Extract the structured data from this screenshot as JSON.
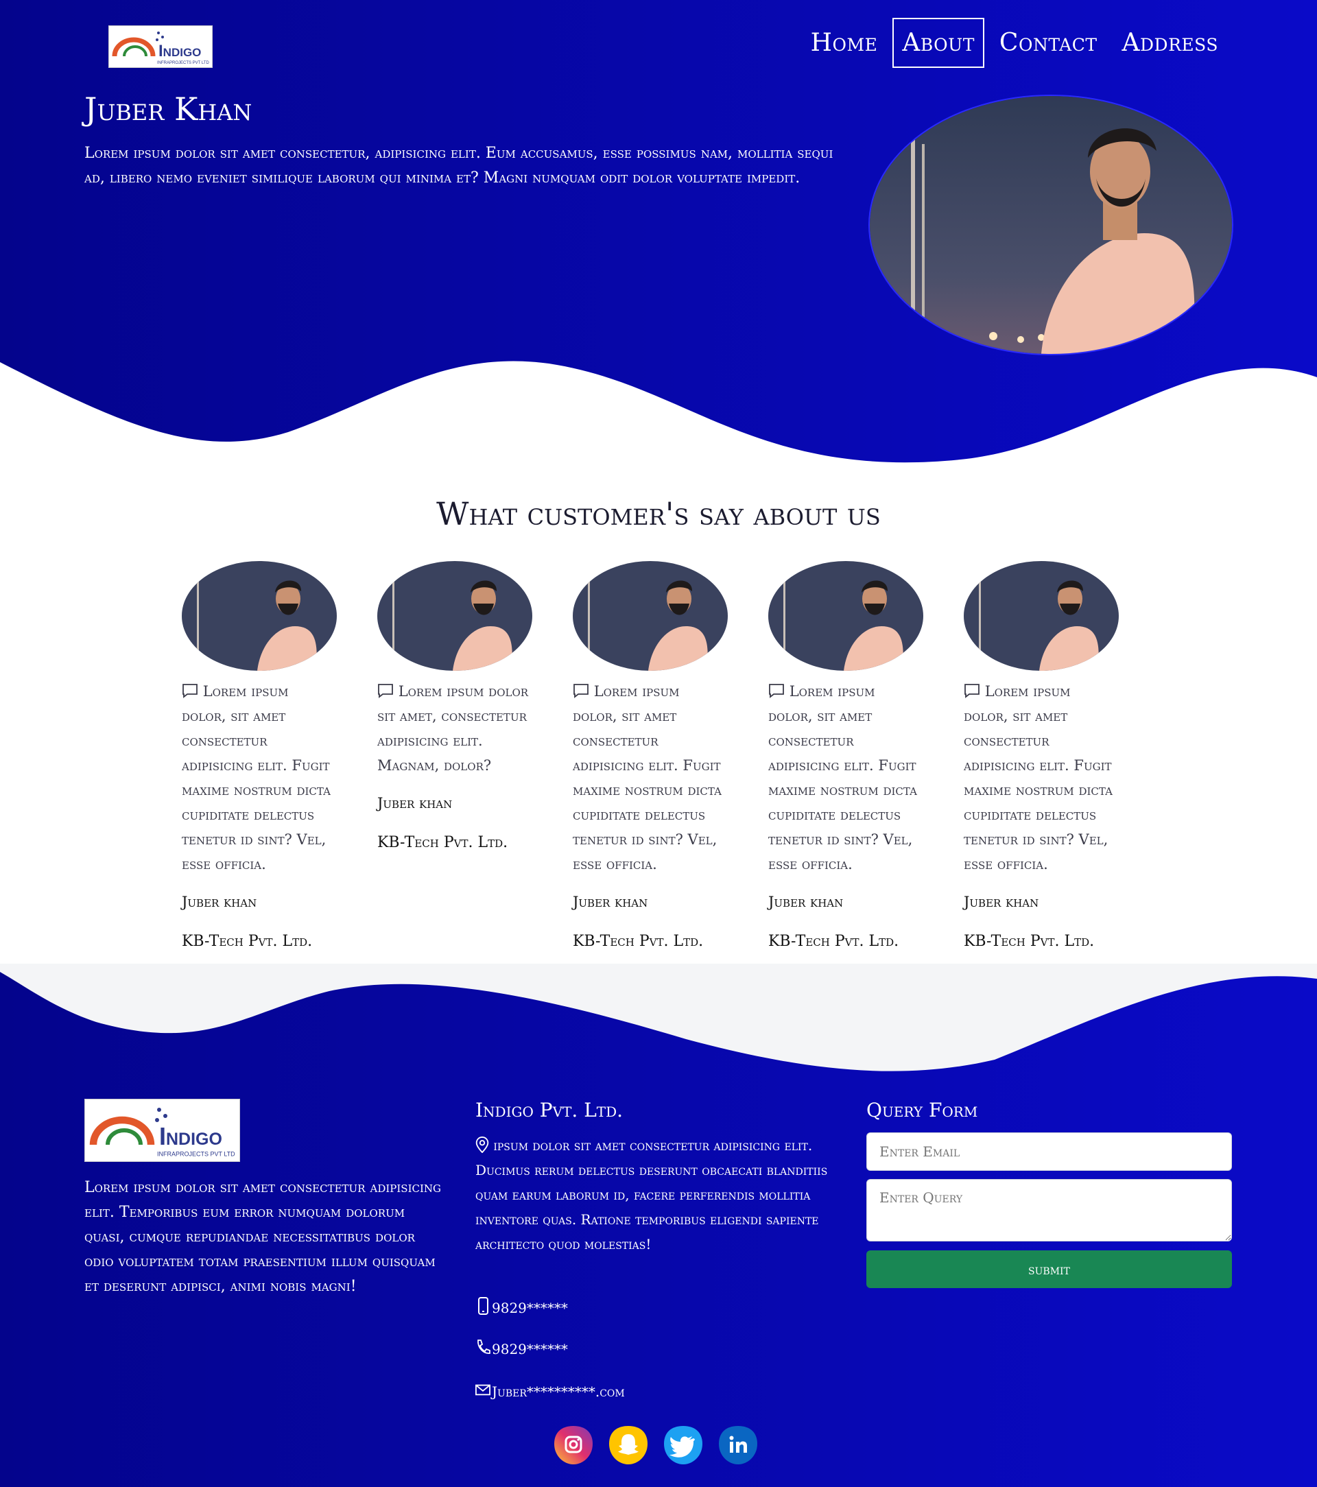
{
  "brand": {
    "name": "Indigo",
    "tagline": "INFRAPROJECTS PVT LTD"
  },
  "nav": {
    "items": [
      "Home",
      "About",
      "Contact",
      "Address"
    ],
    "active": "About"
  },
  "hero": {
    "title": "Juber Khan",
    "text": "Lorem ipsum dolor sit amet consectetur, adipisicing elit. Eum accusamus, esse possimus nam, mollitia sequi ad, libero nemo eveniet similique laborum qui minima et? Magni numquam odit dolor voluptate impedit."
  },
  "testimonials": {
    "title": "What customer's say about us",
    "items": [
      {
        "text": "Lorem ipsum dolor, sit amet consectetur adipisicing elit. Fugit maxime nostrum dicta cupiditate delectus tenetur id sint? Vel, esse officia.",
        "name": "Juber khan",
        "company": "KB-Tech Pvt. Ltd."
      },
      {
        "text": "Lorem ipsum dolor sit amet, consectetur adipisicing elit. Magnam, dolor?",
        "name": "Juber khan",
        "company": "KB-Tech Pvt. Ltd."
      },
      {
        "text": "Lorem ipsum dolor, sit amet consectetur adipisicing elit. Fugit maxime nostrum dicta cupiditate delectus tenetur id sint? Vel, esse officia.",
        "name": "Juber khan",
        "company": "KB-Tech Pvt. Ltd."
      },
      {
        "text": "Lorem ipsum dolor, sit amet consectetur adipisicing elit. Fugit maxime nostrum dicta cupiditate delectus tenetur id sint? Vel, esse officia.",
        "name": "Juber khan",
        "company": "KB-Tech Pvt. Ltd."
      },
      {
        "text": "Lorem ipsum dolor, sit amet consectetur adipisicing elit. Fugit maxime nostrum dicta cupiditate delectus tenetur id sint? Vel, esse officia.",
        "name": "Juber khan",
        "company": "KB-Tech Pvt. Ltd."
      }
    ]
  },
  "footer": {
    "about": "Lorem ipsum dolor sit amet consectetur adipisicing elit. Temporibus eum error numquam dolorum quasi, cumque repudiandae necessitatibus dolor odio voluptatem totam praesentium illum quisquam et deserunt adipisci, animi nobis magni!",
    "company_title": "Indigo Pvt. Ltd.",
    "address": "ipsum dolor sit amet consectetur adipisicing elit. Ducimus rerum delectus deserunt obcaecati blanditiis quam earum laborum id, facere perferendis mollitia inventore quas. Ratione temporibus eligendi sapiente architecto quod molestias!",
    "mobile": "9829******",
    "phone": "9829******",
    "email": "Juber**********.com",
    "form_title": "Query Form",
    "email_placeholder": "Enter Email",
    "query_placeholder": "Enter Query",
    "submit_label": "submit"
  },
  "social": [
    "instagram-icon",
    "snapchat-icon",
    "twitter-icon",
    "linkedin-icon"
  ],
  "colors": {
    "primary_dark": "#04048c",
    "primary_light": "#0a0ac8",
    "submit": "#198754"
  }
}
